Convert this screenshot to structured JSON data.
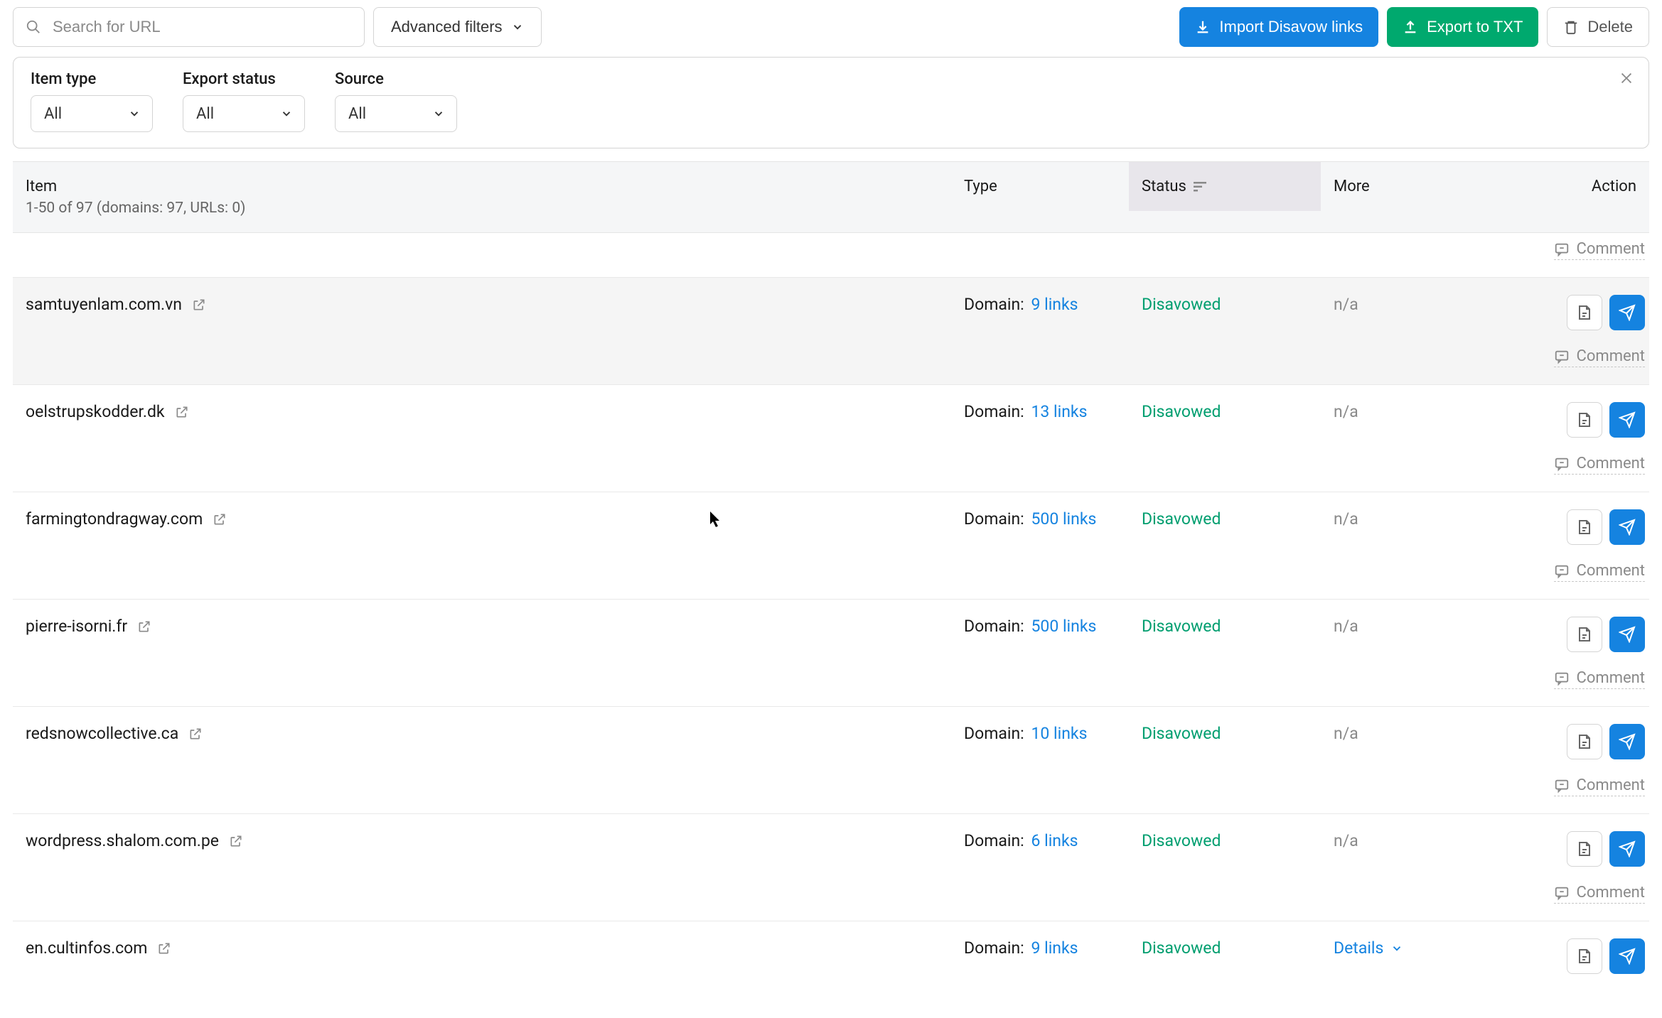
{
  "toolbar": {
    "search_placeholder": "Search for URL",
    "adv_filter_label": "Advanced filters",
    "import_label": "Import Disavow links",
    "export_label": "Export to TXT",
    "delete_label": "Delete"
  },
  "filters": {
    "groups": [
      {
        "label": "Item type",
        "value": "All"
      },
      {
        "label": "Export status",
        "value": "All"
      },
      {
        "label": "Source",
        "value": "All"
      }
    ]
  },
  "columns": {
    "item": "Item",
    "item_sub": "1-50 of 97 (domains: 97, URLs: 0)",
    "type": "Type",
    "status": "Status",
    "more": "More",
    "action": "Action"
  },
  "comment_label": "Comment",
  "partial_top_row": {
    "show_comment_only": true
  },
  "rows": [
    {
      "domain": "samtuyenlam.com.vn",
      "type_prefix": "Domain:",
      "links": "9 links",
      "status": "Disavowed",
      "more": "n/a",
      "highlight": true,
      "details": false
    },
    {
      "domain": "oelstrupskodder.dk",
      "type_prefix": "Domain:",
      "links": "13 links",
      "status": "Disavowed",
      "more": "n/a",
      "highlight": false,
      "details": false
    },
    {
      "domain": "farmingtondragway.com",
      "type_prefix": "Domain:",
      "links": "500 links",
      "status": "Disavowed",
      "more": "n/a",
      "highlight": false,
      "details": false
    },
    {
      "domain": "pierre-isorni.fr",
      "type_prefix": "Domain:",
      "links": "500 links",
      "status": "Disavowed",
      "more": "n/a",
      "highlight": false,
      "details": false
    },
    {
      "domain": "redsnowcollective.ca",
      "type_prefix": "Domain:",
      "links": "10 links",
      "status": "Disavowed",
      "more": "n/a",
      "highlight": false,
      "details": false
    },
    {
      "domain": "wordpress.shalom.com.pe",
      "type_prefix": "Domain:",
      "links": "6 links",
      "status": "Disavowed",
      "more": "n/a",
      "highlight": false,
      "details": false
    },
    {
      "domain": "en.cultinfos.com",
      "type_prefix": "Domain:",
      "links": "9 links",
      "status": "Disavowed",
      "more": "Details",
      "highlight": false,
      "details": true
    }
  ],
  "colors": {
    "blue": "#1583e0",
    "green": "#00a96e",
    "status_green": "#009e6f"
  }
}
